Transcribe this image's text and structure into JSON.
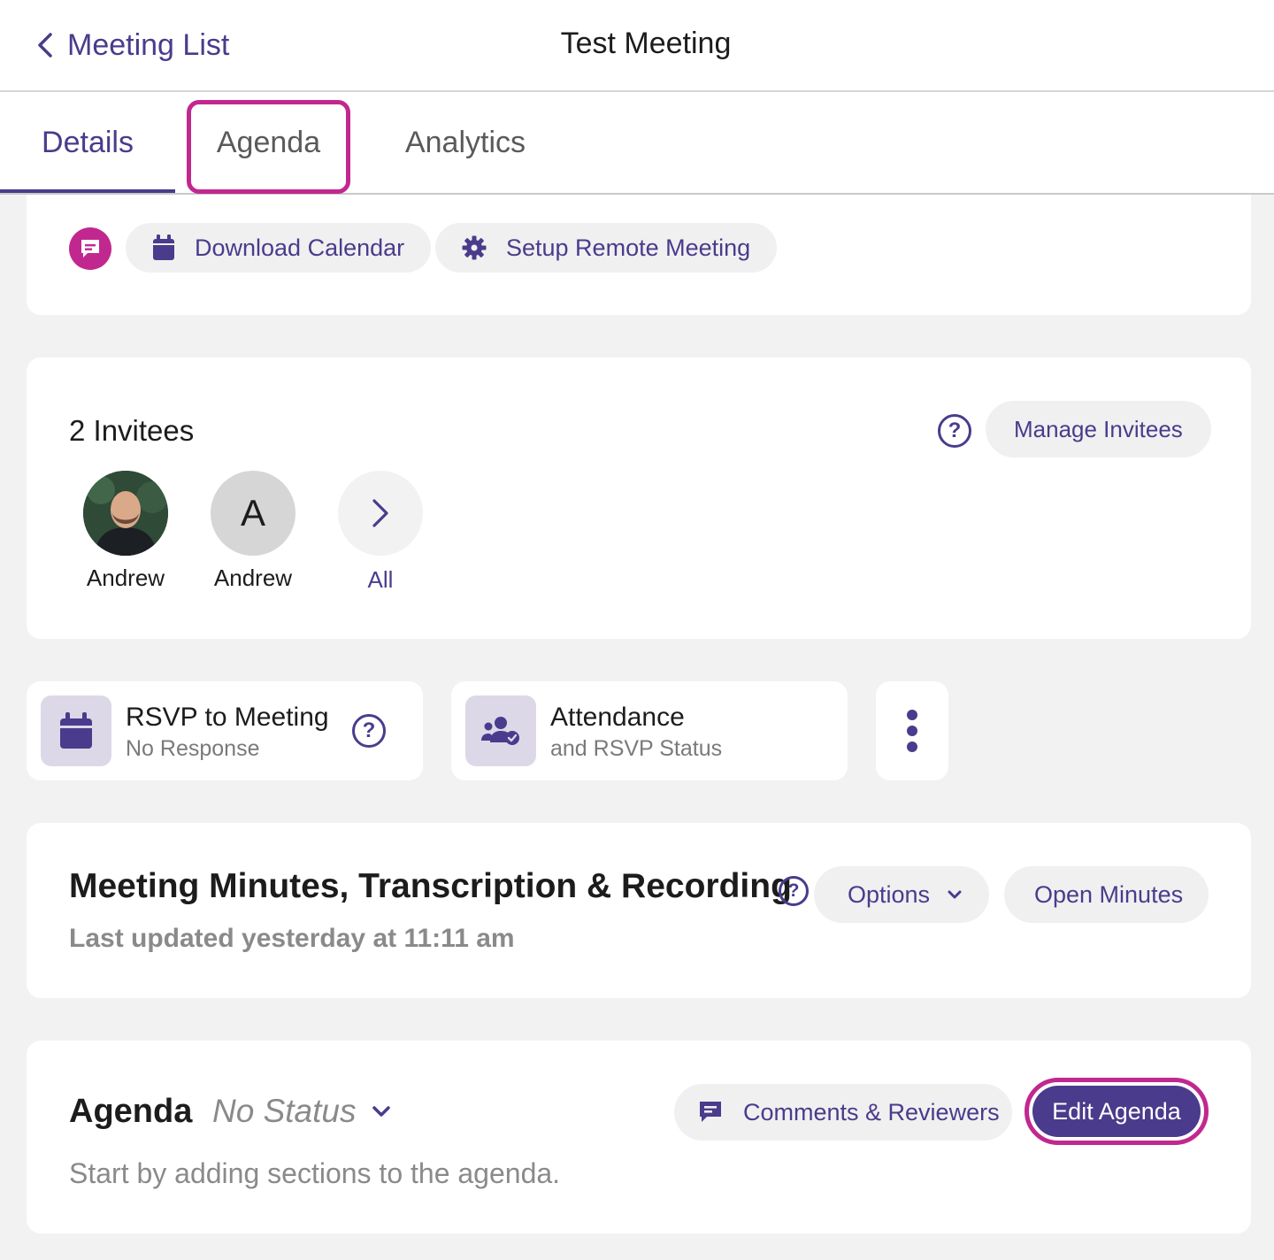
{
  "header": {
    "back_label": "Meeting List",
    "title": "Test Meeting"
  },
  "tabs": [
    {
      "label": "Details",
      "active": true
    },
    {
      "label": "Agenda",
      "active": false,
      "highlighted": true
    },
    {
      "label": "Analytics",
      "active": false
    }
  ],
  "toolbar": {
    "download_calendar": "Download Calendar",
    "setup_remote": "Setup Remote Meeting"
  },
  "invitees": {
    "title": "2 Invitees",
    "manage_label": "Manage Invitees",
    "people": [
      {
        "name": "Andrew",
        "avatar": "photo"
      },
      {
        "name": "Andrew",
        "initial": "A"
      }
    ],
    "all_label": "All"
  },
  "actions": {
    "rsvp_title": "RSVP to Meeting",
    "rsvp_status": "No Response",
    "attendance_title": "Attendance",
    "attendance_sub": "and RSVP Status"
  },
  "minutes": {
    "title": "Meeting Minutes, Transcription & Recording",
    "updated": "Last updated yesterday at 11:11 am",
    "options_label": "Options",
    "open_label": "Open Minutes"
  },
  "agenda": {
    "title": "Agenda",
    "status": "No Status",
    "comments_label": "Comments & Reviewers",
    "edit_label": "Edit Agenda",
    "empty_text": "Start by adding sections to the agenda."
  },
  "colors": {
    "accent": "#4b3b8c",
    "highlight": "#c1288f",
    "background": "#f2f2f2",
    "icon_box": "#dcd8e8"
  }
}
